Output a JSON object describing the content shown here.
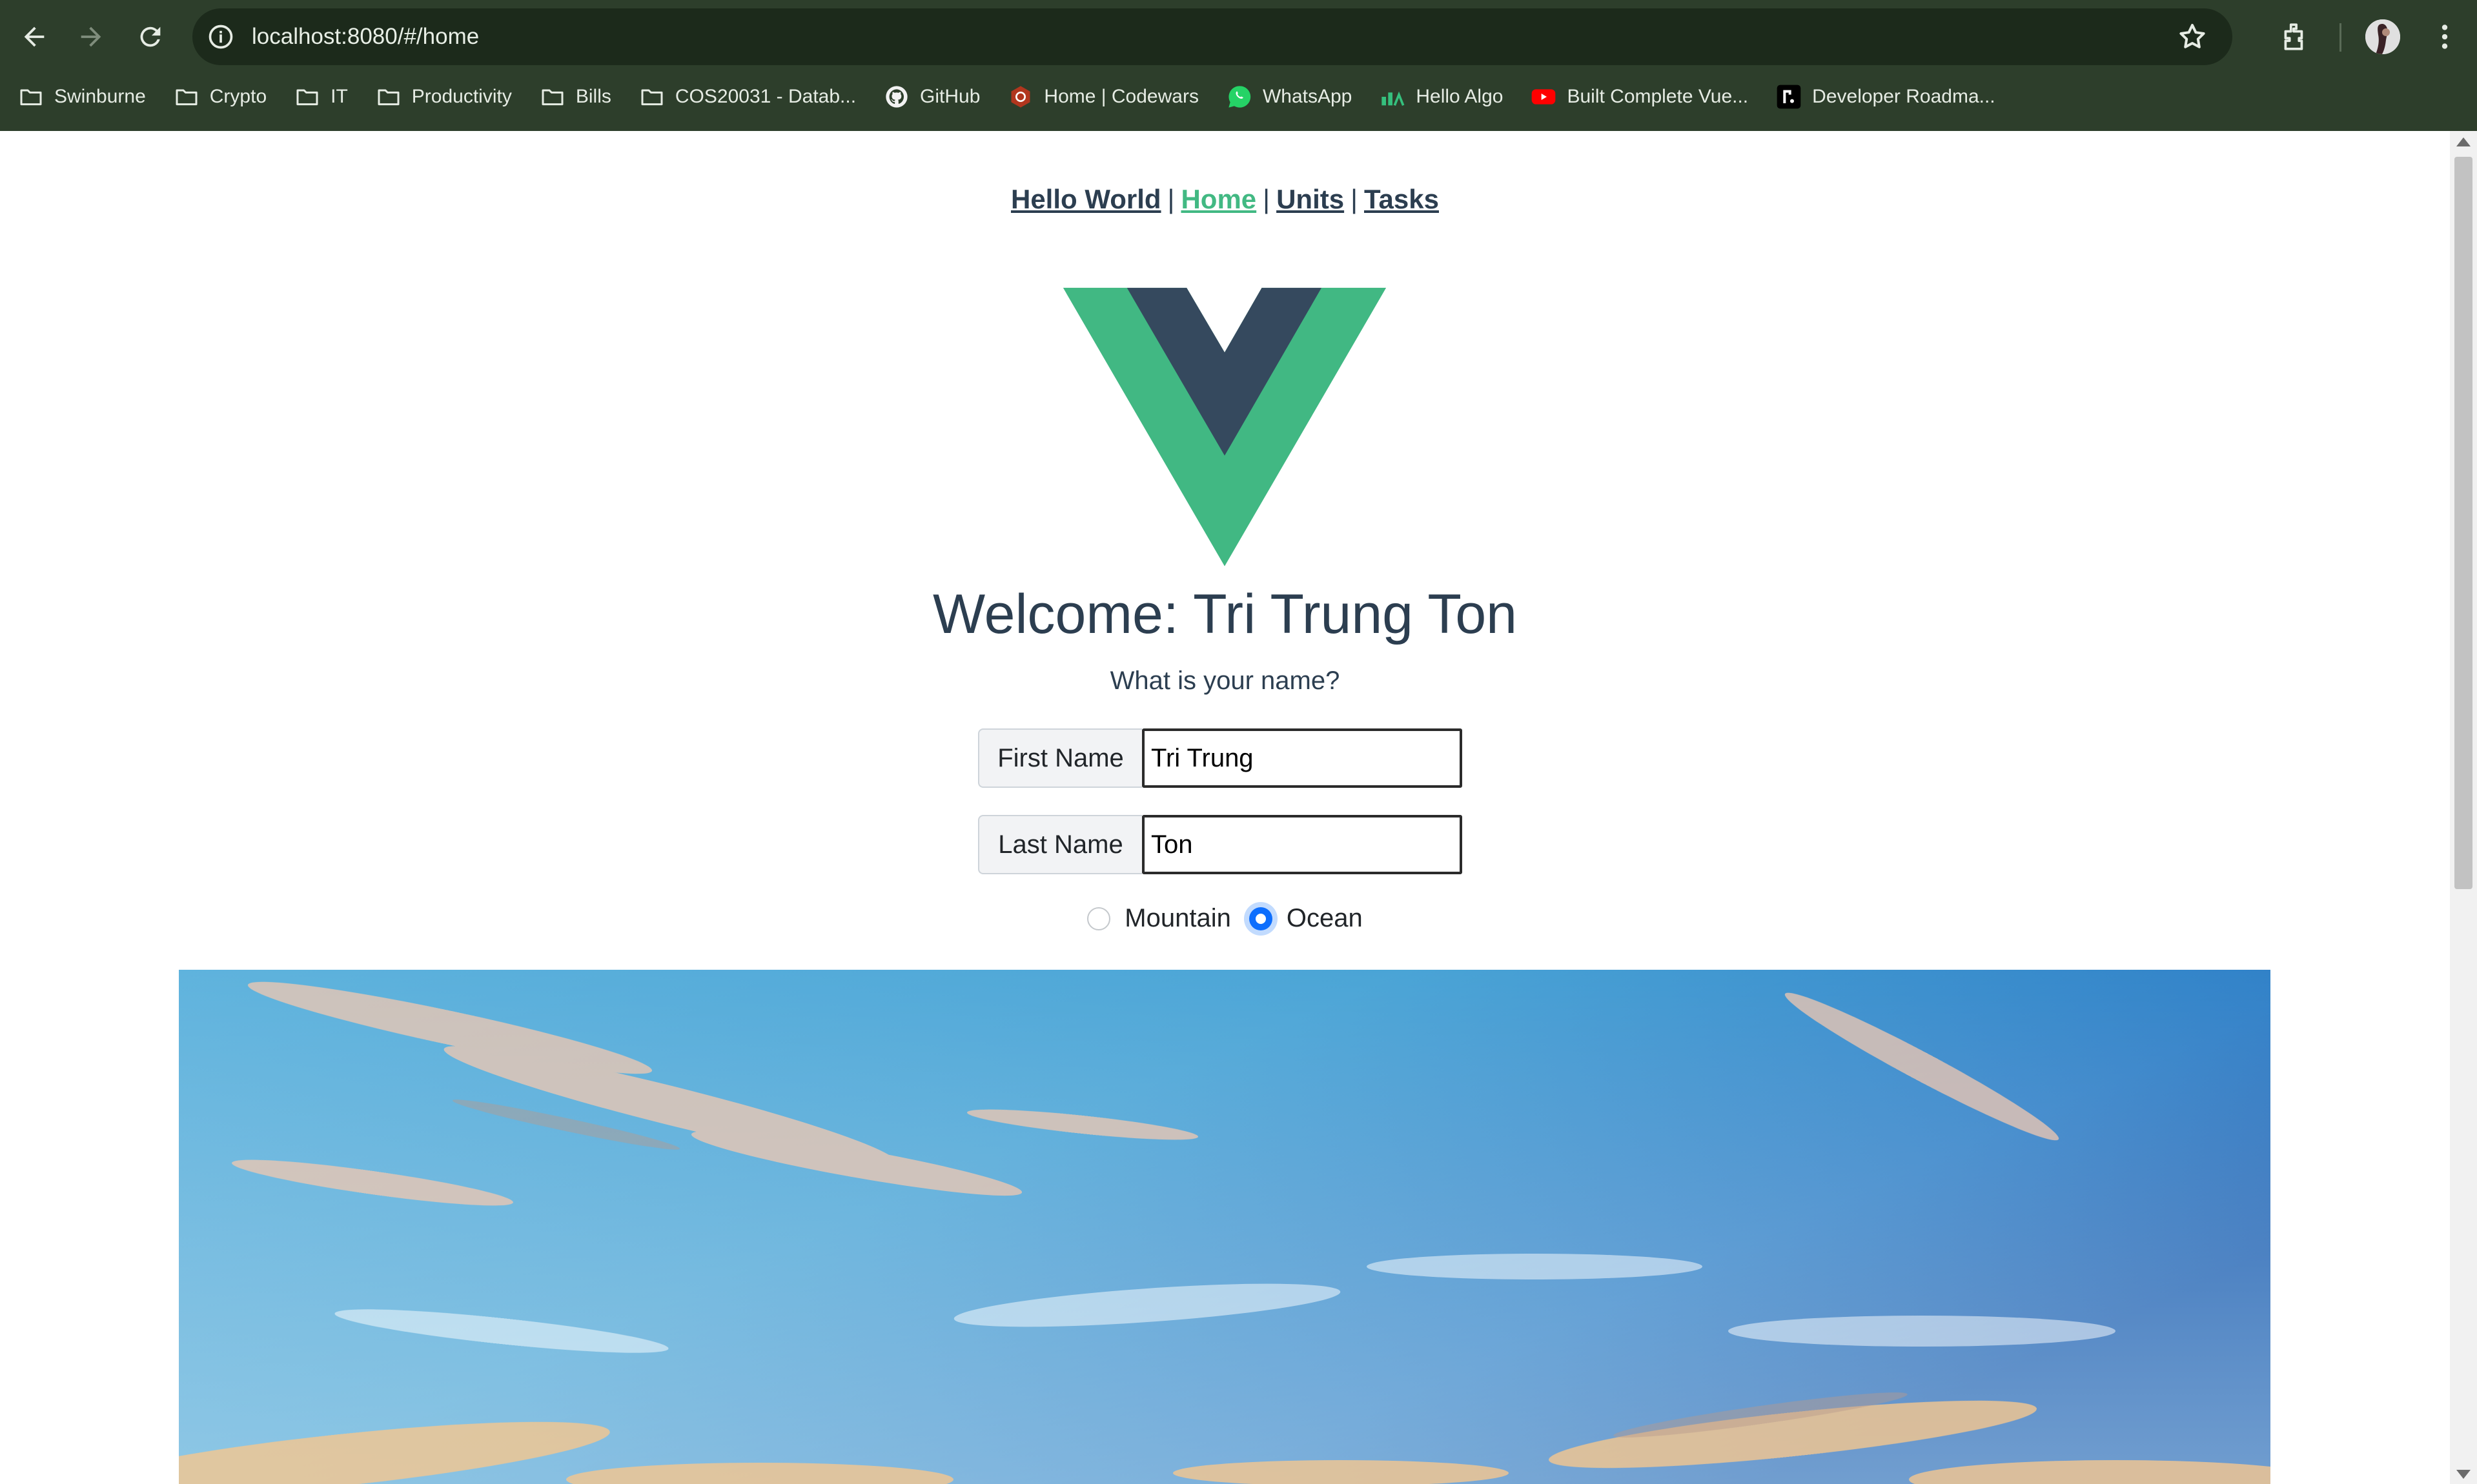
{
  "browser": {
    "url": "localhost:8080/#/home",
    "bookmarks": [
      {
        "label": "Swinburne",
        "icon": "folder-icon"
      },
      {
        "label": "Crypto",
        "icon": "folder-icon"
      },
      {
        "label": "IT",
        "icon": "folder-icon"
      },
      {
        "label": "Productivity",
        "icon": "folder-icon"
      },
      {
        "label": "Bills",
        "icon": "folder-icon"
      },
      {
        "label": "COS20031 - Datab...",
        "icon": "folder-icon"
      },
      {
        "label": "GitHub",
        "icon": "github-icon"
      },
      {
        "label": "Home | Codewars",
        "icon": "codewars-icon"
      },
      {
        "label": "WhatsApp",
        "icon": "whatsapp-icon"
      },
      {
        "label": "Hello Algo",
        "icon": "hello-algo-icon"
      },
      {
        "label": "Built Complete Vue...",
        "icon": "youtube-icon"
      },
      {
        "label": "Developer Roadma...",
        "icon": "roadmap-icon"
      }
    ],
    "colors": {
      "toolbar": "#2d3e2b",
      "omnibox": "#1c2a1b"
    }
  },
  "nav": {
    "links": [
      "Hello World",
      "Home",
      "Units",
      "Tasks"
    ],
    "separator": "|",
    "active": "Home"
  },
  "main": {
    "welcome": "Welcome: Tri Trung Ton",
    "question": "What is your name?",
    "first_name_label": "First Name",
    "first_name_value": "Tri Trung",
    "last_name_label": "Last Name",
    "last_name_value": "Ton",
    "radio_options": [
      "Mountain",
      "Ocean"
    ],
    "selected_radio": "Ocean"
  },
  "colors": {
    "vue_green": "#42b883",
    "vue_dark": "#35495e",
    "text": "#2c3e50",
    "link_active": "#42b983",
    "radio_accent": "#0d6efd"
  }
}
